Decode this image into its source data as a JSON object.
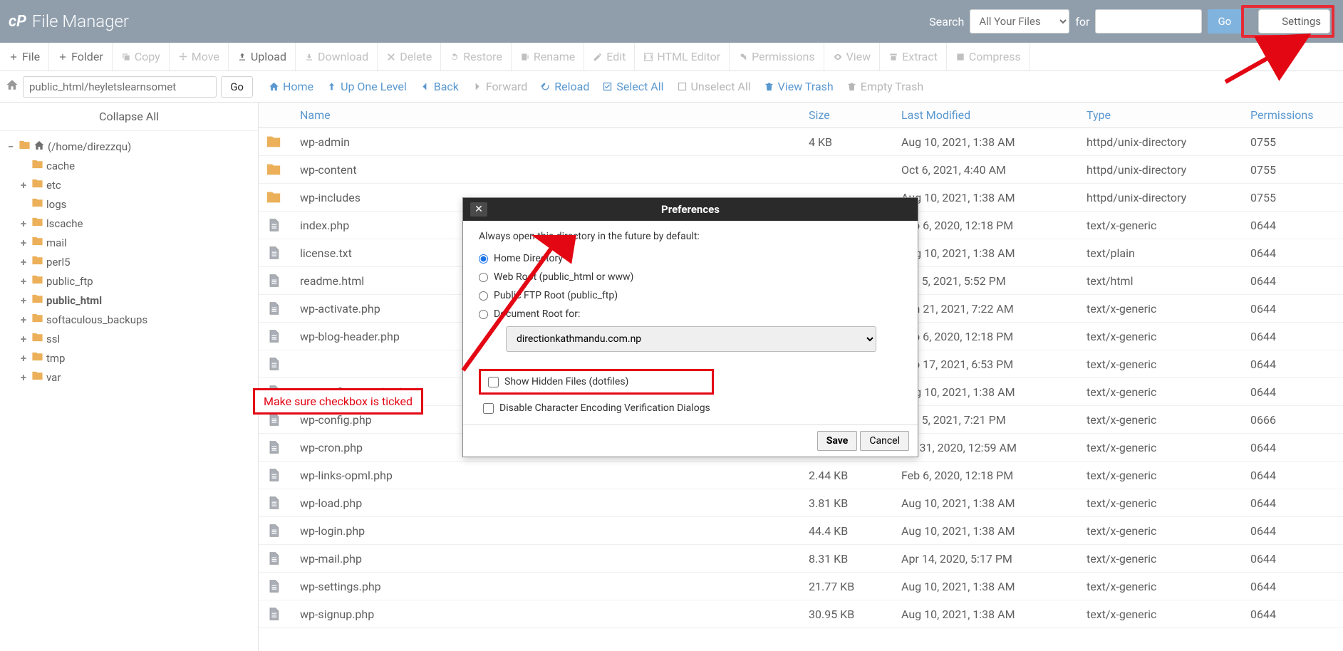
{
  "header": {
    "app_title": "File Manager",
    "search_label": "Search",
    "search_scope": "All Your Files",
    "for_label": "for",
    "go_label": "Go",
    "settings_label": "Settings"
  },
  "toolbar": [
    {
      "label": "File",
      "icon": "plus",
      "dim": false
    },
    {
      "label": "Folder",
      "icon": "plus",
      "dim": false
    },
    {
      "label": "Copy",
      "icon": "copy",
      "dim": true
    },
    {
      "label": "Move",
      "icon": "move",
      "dim": true
    },
    {
      "label": "Upload",
      "icon": "upload",
      "dim": false
    },
    {
      "label": "Download",
      "icon": "download",
      "dim": true
    },
    {
      "label": "Delete",
      "icon": "x",
      "dim": true
    },
    {
      "label": "Restore",
      "icon": "restore",
      "dim": true
    },
    {
      "label": "Rename",
      "icon": "rename",
      "dim": true
    },
    {
      "label": "Edit",
      "icon": "pencil",
      "dim": true
    },
    {
      "label": "HTML Editor",
      "icon": "html",
      "dim": true
    },
    {
      "label": "Permissions",
      "icon": "key",
      "dim": true
    },
    {
      "label": "View",
      "icon": "eye",
      "dim": true
    },
    {
      "label": "Extract",
      "icon": "extract",
      "dim": true
    },
    {
      "label": "Compress",
      "icon": "compress",
      "dim": true
    }
  ],
  "breadcrumb": {
    "path": "public_html/heyletslearnsomet",
    "go_label": "Go"
  },
  "actions": [
    {
      "label": "Home",
      "icon": "home",
      "dim": false
    },
    {
      "label": "Up One Level",
      "icon": "up",
      "dim": false
    },
    {
      "label": "Back",
      "icon": "back",
      "dim": false
    },
    {
      "label": "Forward",
      "icon": "forward",
      "dim": true
    },
    {
      "label": "Reload",
      "icon": "reload",
      "dim": false
    },
    {
      "label": "Select All",
      "icon": "check",
      "dim": false
    },
    {
      "label": "Unselect All",
      "icon": "uncheck",
      "dim": true
    },
    {
      "label": "View Trash",
      "icon": "trash",
      "dim": false
    },
    {
      "label": "Empty Trash",
      "icon": "trash",
      "dim": true
    }
  ],
  "sidebar": {
    "collapse_label": "Collapse All",
    "root": "(/home/direzzqu)",
    "items": [
      {
        "label": "cache",
        "exp": "",
        "indent": 1
      },
      {
        "label": "etc",
        "exp": "+",
        "indent": 1
      },
      {
        "label": "logs",
        "exp": "",
        "indent": 1
      },
      {
        "label": "lscache",
        "exp": "+",
        "indent": 1
      },
      {
        "label": "mail",
        "exp": "+",
        "indent": 1
      },
      {
        "label": "perl5",
        "exp": "+",
        "indent": 1
      },
      {
        "label": "public_ftp",
        "exp": "+",
        "indent": 1
      },
      {
        "label": "public_html",
        "exp": "+",
        "indent": 1,
        "bold": true
      },
      {
        "label": "softaculous_backups",
        "exp": "+",
        "indent": 1
      },
      {
        "label": "ssl",
        "exp": "+",
        "indent": 1
      },
      {
        "label": "tmp",
        "exp": "+",
        "indent": 1
      },
      {
        "label": "var",
        "exp": "+",
        "indent": 1
      }
    ]
  },
  "table": {
    "headers": {
      "name": "Name",
      "size": "Size",
      "modified": "Last Modified",
      "type": "Type",
      "perm": "Permissions"
    },
    "rows": [
      {
        "icon": "folder",
        "name": "wp-admin",
        "size": "4 KB",
        "modified": "Aug 10, 2021, 1:38 AM",
        "type": "httpd/unix-directory",
        "perm": "0755"
      },
      {
        "icon": "folder",
        "name": "wp-content",
        "size": "",
        "modified": "Oct 6, 2021, 4:40 AM",
        "type": "httpd/unix-directory",
        "perm": "0755"
      },
      {
        "icon": "folder",
        "name": "wp-includes",
        "size": "",
        "modified": "Aug 10, 2021, 1:38 AM",
        "type": "httpd/unix-directory",
        "perm": "0755"
      },
      {
        "icon": "file",
        "name": "index.php",
        "size": "",
        "modified": "Feb 6, 2020, 12:18 PM",
        "type": "text/x-generic",
        "perm": "0644"
      },
      {
        "icon": "file",
        "name": "license.txt",
        "size": "",
        "modified": "Aug 10, 2021, 1:38 AM",
        "type": "text/plain",
        "perm": "0644"
      },
      {
        "icon": "file",
        "name": "readme.html",
        "size": "",
        "modified": "Oct 5, 2021, 5:52 PM",
        "type": "text/html",
        "perm": "0644"
      },
      {
        "icon": "file",
        "name": "wp-activate.php",
        "size": "",
        "modified": "Jan 21, 2021, 7:22 AM",
        "type": "text/x-generic",
        "perm": "0644"
      },
      {
        "icon": "file",
        "name": "wp-blog-header.php",
        "size": "",
        "modified": "Feb 6, 2020, 12:18 PM",
        "type": "text/x-generic",
        "perm": "0644"
      },
      {
        "icon": "file",
        "name": "",
        "size": "",
        "modified": "Feb 17, 2021, 6:53 PM",
        "type": "text/x-generic",
        "perm": "0644"
      },
      {
        "icon": "file",
        "name": "wp-config-sample.php",
        "size": "",
        "modified": "Aug 10, 2021, 1:38 AM",
        "type": "text/x-generic",
        "perm": "0644"
      },
      {
        "icon": "file",
        "name": "wp-config.php",
        "size": "",
        "modified": "Oct 5, 2021, 7:21 PM",
        "type": "text/x-generic",
        "perm": "0666"
      },
      {
        "icon": "file",
        "name": "wp-cron.php",
        "size": "",
        "modified": "Jul 31, 2020, 12:59 AM",
        "type": "text/x-generic",
        "perm": "0644"
      },
      {
        "icon": "file",
        "name": "wp-links-opml.php",
        "size": "2.44 KB",
        "modified": "Feb 6, 2020, 12:18 PM",
        "type": "text/x-generic",
        "perm": "0644"
      },
      {
        "icon": "file",
        "name": "wp-load.php",
        "size": "3.81 KB",
        "modified": "Aug 10, 2021, 1:38 AM",
        "type": "text/x-generic",
        "perm": "0644"
      },
      {
        "icon": "file",
        "name": "wp-login.php",
        "size": "44.4 KB",
        "modified": "Aug 10, 2021, 1:38 AM",
        "type": "text/x-generic",
        "perm": "0644"
      },
      {
        "icon": "file",
        "name": "wp-mail.php",
        "size": "8.31 KB",
        "modified": "Apr 14, 2020, 5:17 PM",
        "type": "text/x-generic",
        "perm": "0644"
      },
      {
        "icon": "file",
        "name": "wp-settings.php",
        "size": "21.77 KB",
        "modified": "Aug 10, 2021, 1:38 AM",
        "type": "text/x-generic",
        "perm": "0644"
      },
      {
        "icon": "file",
        "name": "wp-signup.php",
        "size": "30.95 KB",
        "modified": "Aug 10, 2021, 1:38 AM",
        "type": "text/x-generic",
        "perm": "0644"
      }
    ]
  },
  "modal": {
    "title": "Preferences",
    "lead": "Always open this directory in the future by default:",
    "opt_home": "Home Directory",
    "opt_web": "Web Root (public_html or www)",
    "opt_ftp": "Public FTP Root (public_ftp)",
    "opt_doc": "Document Root for:",
    "doc_value": "directionkathmandu.com.np",
    "show_hidden": "Show Hidden Files (dotfiles)",
    "disable_enc": "Disable Character Encoding Verification Dialogs",
    "save": "Save",
    "cancel": "Cancel"
  },
  "annotation": {
    "text": "Make sure checkbox is ticked"
  }
}
